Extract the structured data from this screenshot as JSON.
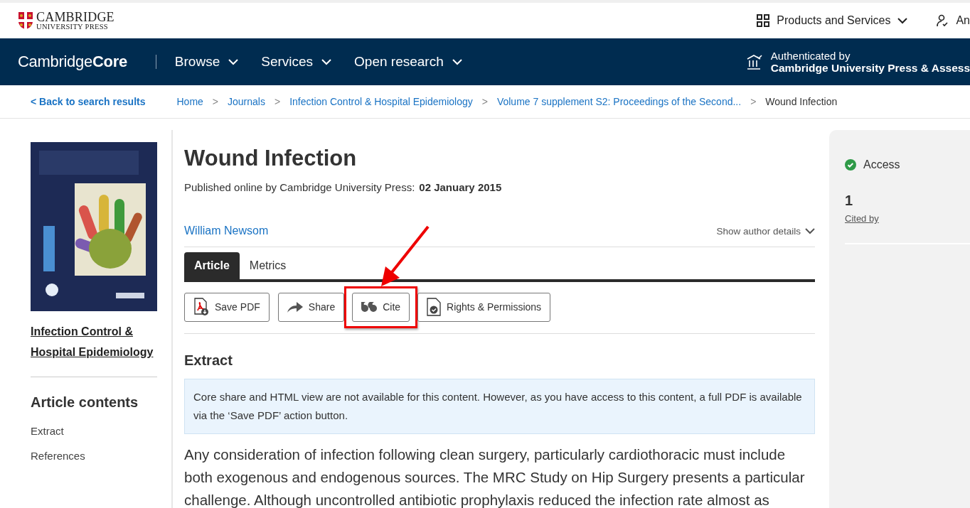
{
  "header": {
    "logo": {
      "line_1": "CAMBRIDGE",
      "line_2": "UNIVERSITY PRESS"
    },
    "menu": [
      {
        "label": "Products and Services",
        "kind": "grid"
      },
      {
        "label": "An",
        "kind": "person"
      }
    ]
  },
  "nav": {
    "brand": {
      "light": "Cambridge",
      "bold": "Core"
    },
    "items": [
      "Browse",
      "Services",
      "Open research"
    ],
    "auth": {
      "label": "Authenticated by",
      "institution": "Cambridge University Press & Assess"
    }
  },
  "breadcrumbs": {
    "back": "< Back to search results",
    "items": [
      "Home",
      "Journals",
      "Infection Control & Hospital Epidemiology",
      "Volume 7 supplement S2: Proceedings of the Second..."
    ],
    "current": "Wound Infection",
    "separator": ">"
  },
  "sidebar": {
    "cover": {
      "kind": "picture"
    },
    "journal": "Infection Control & Hospital Epidemiology",
    "contents_title": "Article contents",
    "contents": [
      "Extract",
      "References"
    ]
  },
  "article": {
    "title": "Wound Infection",
    "published_prefix": "Published online by Cambridge University Press:",
    "published_date": "02 January 2015",
    "author": "William Newsom",
    "author_details": "Show author details",
    "tabs": [
      {
        "label": "Article",
        "selected": true
      },
      {
        "label": "Metrics",
        "selected": false
      }
    ],
    "actions": [
      {
        "label": "Save PDF",
        "kind": "pdf",
        "highlighted": false
      },
      {
        "label": "Share",
        "kind": "share",
        "highlighted": false
      },
      {
        "label": "Cite",
        "kind": "cite",
        "highlighted": true
      },
      {
        "label": "Rights & Permissions",
        "kind": "rights",
        "highlighted": false
      }
    ],
    "section_heading": "Extract",
    "notice": "Core share and HTML view are not available for this content. However, as you have access to this content, a full PDF is available via the ‘Save PDF’ action button.",
    "body": "Any consideration of infection following clean surgery, particularly cardiothoracic must include both exogenous and endogenous sources. The MRC Study on Hip Surgery presents a particular challenge. Although uncontrolled antibiotic prophylaxis reduced the infection rate almost as"
  },
  "side_panel": {
    "access": "Access",
    "cited_count": "1",
    "cited_label": "Cited by"
  }
}
